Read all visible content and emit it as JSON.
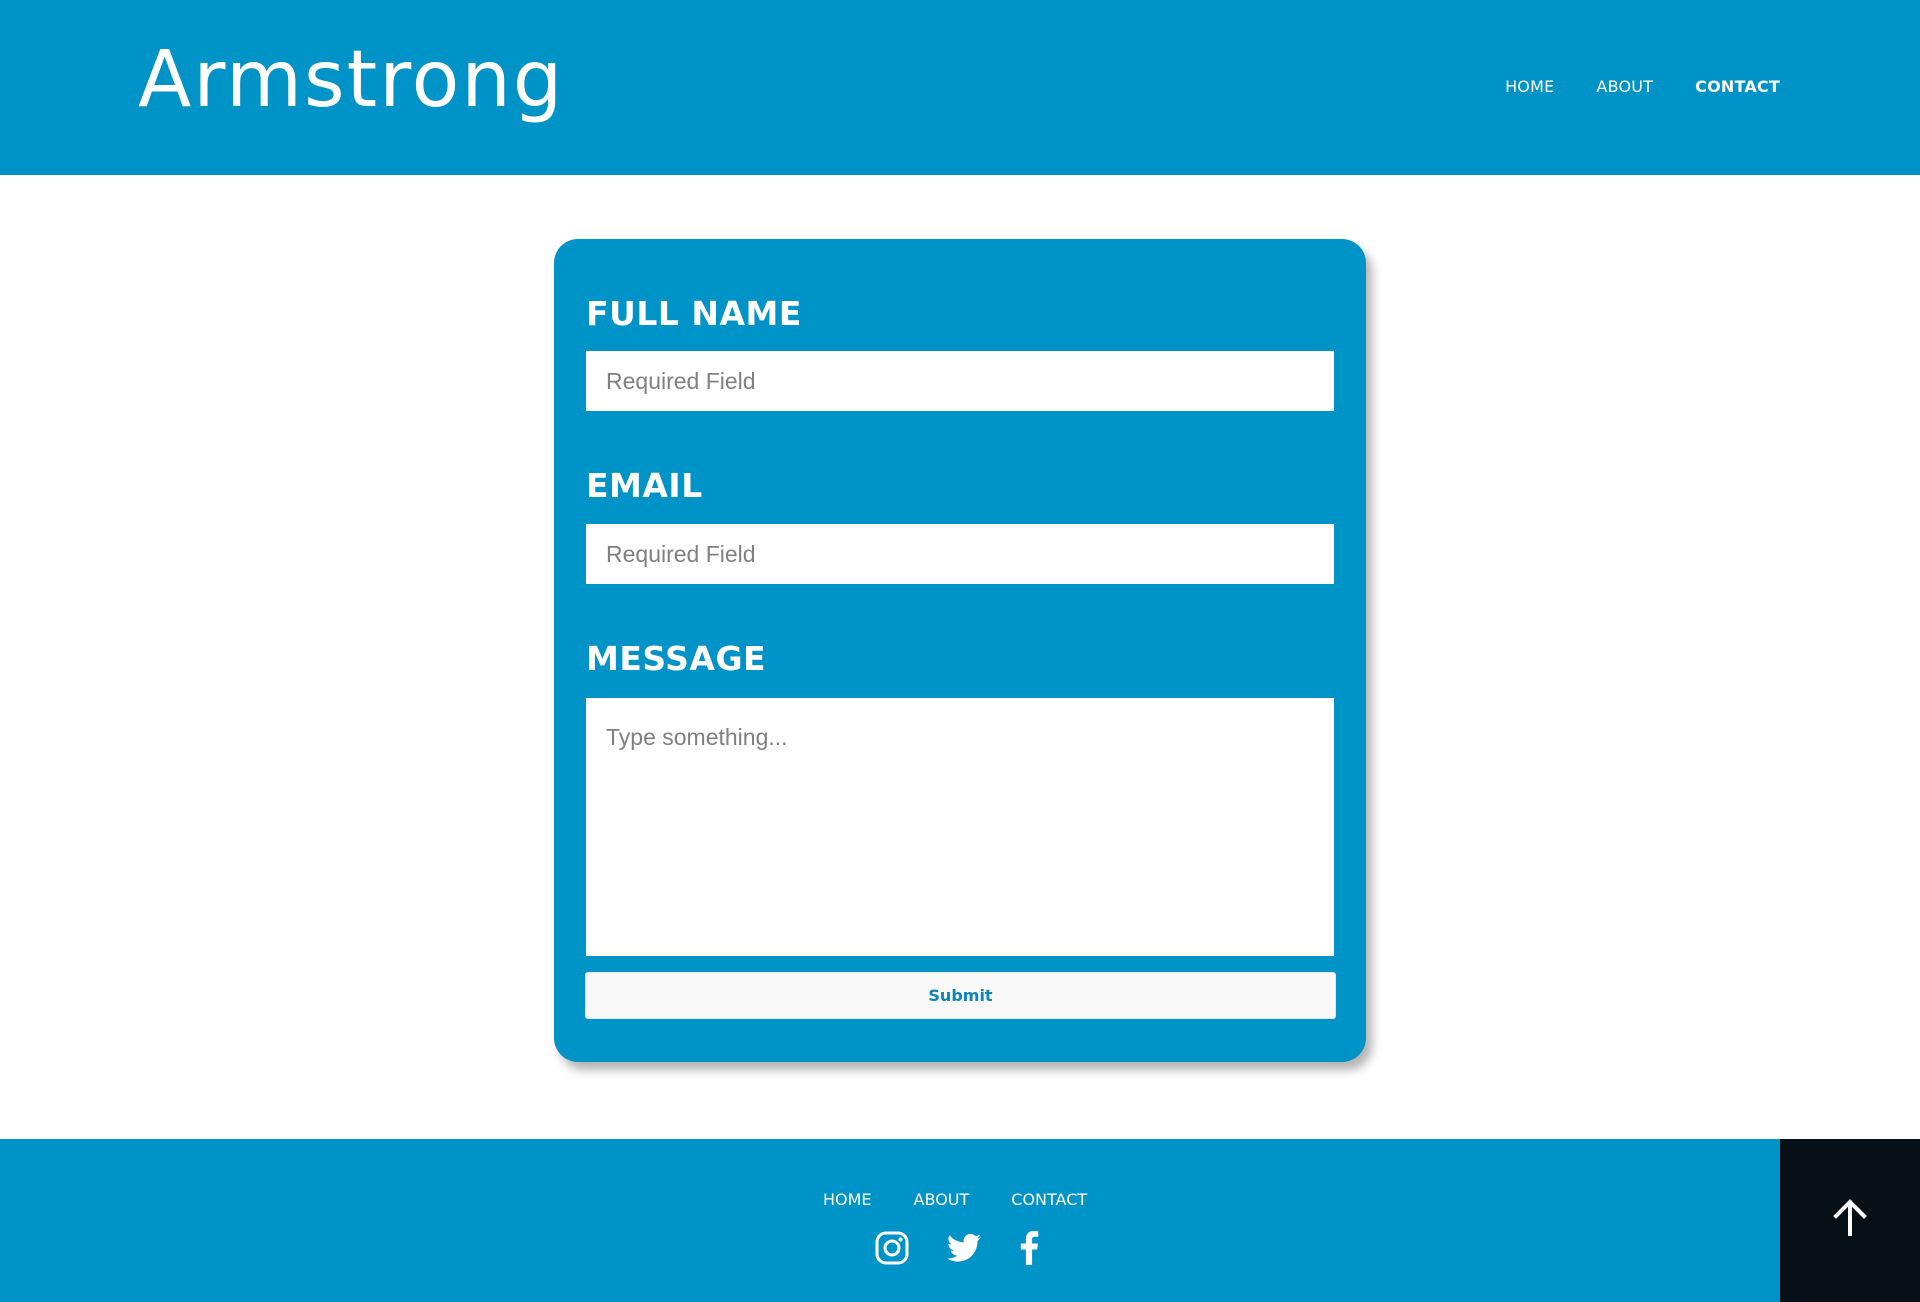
{
  "brand": {
    "title": "Armstrong"
  },
  "nav": {
    "items": [
      {
        "label": "HOME"
      },
      {
        "label": "ABOUT"
      },
      {
        "label": "CONTACT"
      }
    ],
    "active": "CONTACT"
  },
  "form": {
    "full_name": {
      "label": "FULL NAME",
      "placeholder": "Required Field",
      "value": ""
    },
    "email": {
      "label": "EMAIL",
      "placeholder": "Required Field",
      "value": ""
    },
    "message": {
      "label": "MESSAGE",
      "placeholder": "Type something...",
      "value": ""
    },
    "submit_label": "Submit"
  },
  "footer": {
    "nav": [
      {
        "label": "HOME"
      },
      {
        "label": "ABOUT"
      },
      {
        "label": "CONTACT"
      }
    ],
    "socials": [
      "instagram-icon",
      "twitter-icon",
      "facebook-icon"
    ],
    "back_to_top_icon": "arrow-up-icon"
  },
  "colors": {
    "primary": "#0093c7",
    "dark": "#071017",
    "button_text": "#0a86b8"
  }
}
